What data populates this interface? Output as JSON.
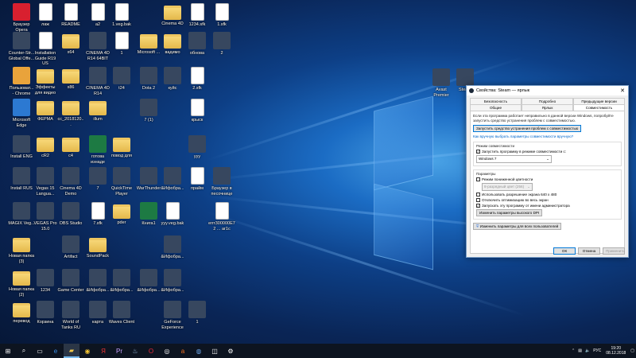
{
  "desktop": {
    "icons": [
      {
        "label": "Браузер Opera",
        "type": "opera"
      },
      {
        "label": "лаж",
        "type": "file"
      },
      {
        "label": "README",
        "type": "file"
      },
      {
        "label": "a2",
        "type": "file"
      },
      {
        "label": "1.veg.bak",
        "type": "file"
      },
      {
        "label": "Cinema 4D",
        "type": "folder"
      },
      {
        "label": "1234.sfk",
        "type": "file"
      },
      {
        "label": "1.sfk",
        "type": "file"
      },
      {
        "label": "Counter-Str... Global Offe...",
        "type": "app"
      },
      {
        "label": "Installation Guide R19 US",
        "type": "file"
      },
      {
        "label": "x64",
        "type": "folder"
      },
      {
        "label": "CINEMA 4D R14 64BIT",
        "type": "app"
      },
      {
        "label": "1",
        "type": "file"
      },
      {
        "label": "Microsoft ...",
        "type": "folder"
      },
      {
        "label": "вадимо",
        "type": "folder"
      },
      {
        "label": "обнова",
        "type": "app"
      },
      {
        "label": "2",
        "type": "app"
      },
      {
        "label": "Пользоват... - Chrome",
        "type": "chrome"
      },
      {
        "label": "Эффекты для видео",
        "type": "folder"
      },
      {
        "label": "x86",
        "type": "folder"
      },
      {
        "label": "CINEMA 4D R14",
        "type": "app"
      },
      {
        "label": "t24",
        "type": "app"
      },
      {
        "label": "Dota 2",
        "type": "app"
      },
      {
        "label": "куйс",
        "type": "app"
      },
      {
        "label": "2.sfk",
        "type": "file"
      },
      {
        "label": "Microsoft Edge",
        "type": "edge"
      },
      {
        "label": "ФЕРМА",
        "type": "folder"
      },
      {
        "label": "cc_2018120...",
        "type": "folder"
      },
      {
        "label": "illum",
        "type": "folder"
      },
      {
        "label": "7 (1)",
        "type": "app"
      },
      {
        "label": "крыск",
        "type": "file"
      },
      {
        "label": "Install ENG",
        "type": "app"
      },
      {
        "label": "cR2",
        "type": "folder"
      },
      {
        "label": "c4",
        "type": "folder"
      },
      {
        "label": "готова изнаде",
        "type": "excel"
      },
      {
        "label": "повод для",
        "type": "folder"
      },
      {
        "label": "yyy",
        "type": "app"
      },
      {
        "label": "Install RUS",
        "type": "app"
      },
      {
        "label": "Vegas 15 Langua...",
        "type": "app"
      },
      {
        "label": "Cinema 4D Demo",
        "type": "app"
      },
      {
        "label": "7",
        "type": "app"
      },
      {
        "label": "QuickTime Player",
        "type": "app"
      },
      {
        "label": "WarThunder",
        "type": "app"
      },
      {
        "label": "&Ифобра...",
        "type": "app"
      },
      {
        "label": "прайм",
        "type": "file"
      },
      {
        "label": "Браузер в песочнице",
        "type": "app"
      },
      {
        "label": "MAGIX Veg...",
        "type": "app"
      },
      {
        "label": "VEGAS Pro 15.0",
        "type": "app"
      },
      {
        "label": "OBS Studio",
        "type": "app"
      },
      {
        "label": "7.sfk",
        "type": "file"
      },
      {
        "label": "pder",
        "type": "folder"
      },
      {
        "label": "Книга1",
        "type": "excel"
      },
      {
        "label": "yyy.veg.bak",
        "type": "file"
      },
      {
        "label": "errr300000E72 ... ar1c",
        "type": "file"
      },
      {
        "label": "Artifact",
        "type": "app"
      },
      {
        "label": "SoundPack",
        "type": "folder"
      },
      {
        "label": "&Ифобра...",
        "type": "app"
      },
      {
        "label": "Новая папка (3)",
        "type": "folder"
      },
      {
        "label": "Новая папка (2)",
        "type": "folder"
      },
      {
        "label": "1234",
        "type": "app"
      },
      {
        "label": "Game Center",
        "type": "app"
      },
      {
        "label": "&Ифобра...",
        "type": "app"
      },
      {
        "label": "&Ифобра...",
        "type": "app"
      },
      {
        "label": "&Ифобра...",
        "type": "app"
      },
      {
        "label": "&Ифобра...",
        "type": "app"
      },
      {
        "label": "перевод",
        "type": "folder"
      },
      {
        "label": "Корзина",
        "type": "app"
      },
      {
        "label": "World of Tanks RU",
        "type": "app"
      },
      {
        "label": "карта",
        "type": "app"
      },
      {
        "label": "Waves Client",
        "type": "app"
      },
      {
        "label": "GeForce Experience",
        "type": "app"
      },
      {
        "label": "1",
        "type": "app"
      },
      {
        "label": "Avast Premier",
        "type": "app"
      },
      {
        "label": "Steam",
        "type": "app"
      }
    ]
  },
  "dialog": {
    "title": "Свойства: Steam — ярлык",
    "close_glyph": "✕",
    "tabs": [
      "Безопасность",
      "Подробно",
      "Предыдущие версии",
      "Общие",
      "Ярлык",
      "Совместимость"
    ],
    "active_tab": "Совместимость",
    "intro": "Если эта программа работает неправильно в данной версии Windows, попробуйте запустить средство устранения проблем с совместимостью.",
    "troubleshoot_button": "Запустить средство устранения проблем с совместимостью",
    "manual_link": "Как вручную выбрать параметры совместимости вручную?",
    "compat_mode": {
      "title": "Режим совместимости",
      "checkbox_label": "Запустить программу в режиме совместимости с:",
      "checked": true,
      "selected_os": "Windows 7"
    },
    "params": {
      "title": "Параметры",
      "reduced_color": "Режим пониженной цветности",
      "color_value": "8-разрядный цвет (256)",
      "res_640": "Использовать разрешение экрана 640 x 480",
      "disable_fullscreen": "Отключить оптимизацию во весь экран",
      "run_as_admin": "Запускать эту программу от имени администратора",
      "dpi_button": "Изменить параметры высокого DPI"
    },
    "all_users_button": "Изменить параметры для всех пользователей",
    "ok": "ОК",
    "cancel": "Отмена",
    "apply": "Применить"
  },
  "taskbar": {
    "lang": "РУС",
    "time": "19:20",
    "date": "08.12.2018",
    "icons": [
      "windows-icon",
      "search-icon",
      "task-view-icon",
      "edge-icon",
      "file-explorer-icon",
      "chrome-icon",
      "yandex-icon",
      "premiere-icon",
      "steam-icon",
      "opera-icon",
      "obs-icon",
      "avast-icon",
      "cinema4d-icon",
      "explorer-icon",
      "settings-icon"
    ]
  }
}
